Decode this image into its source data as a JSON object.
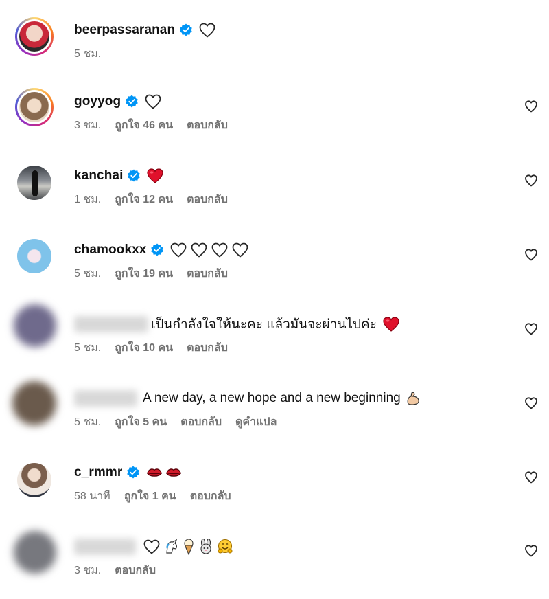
{
  "comments": [
    {
      "username": "beerpassaranan",
      "verified": true,
      "text": "",
      "time": "5 ชม.",
      "likes": "",
      "reply": "",
      "translate": ""
    },
    {
      "username": "goyyog",
      "verified": true,
      "text": "",
      "time": "3 ชม.",
      "likes": "ถูกใจ 46 คน",
      "reply": "ตอบกลับ",
      "translate": ""
    },
    {
      "username": "kanchai",
      "verified": true,
      "text": "",
      "time": "1 ชม.",
      "likes": "ถูกใจ 12 คน",
      "reply": "ตอบกลับ",
      "translate": ""
    },
    {
      "username": "chamookxx",
      "verified": true,
      "text": "",
      "time": "5 ชม.",
      "likes": "ถูกใจ 19 คน",
      "reply": "ตอบกลับ",
      "translate": ""
    },
    {
      "username": "",
      "verified": false,
      "text": "เป็นกำลังใจให้นะคะ แล้วมันจะผ่านไปค่ะ",
      "time": "5 ชม.",
      "likes": "ถูกใจ 10 คน",
      "reply": "ตอบกลับ",
      "translate": ""
    },
    {
      "username": "",
      "verified": false,
      "text": "A new day, a new hope and a new beginning",
      "time": "5 ชม.",
      "likes": "ถูกใจ 5 คน",
      "reply": "ตอบกลับ",
      "translate": "ดูคำแปล"
    },
    {
      "username": "c_rmmr",
      "verified": true,
      "text": "",
      "time": "58 นาที",
      "likes": "ถูกใจ 1 คน",
      "reply": "ตอบกลับ",
      "translate": ""
    },
    {
      "username": "",
      "verified": false,
      "text": "",
      "time": "3 ชม.",
      "likes": "",
      "reply": "ตอบกลับ",
      "translate": ""
    }
  ],
  "icons": {
    "verified": "verified-badge-icon",
    "heart_outline": "heart-outline-icon",
    "heart_red": "red-heart-icon",
    "like": "like-heart-icon",
    "flexed_biceps": "flexed-biceps-emoji",
    "kiss_lips": "kiss-lips-emoji",
    "unicorn": "unicorn-emoji",
    "ice_cream": "ice-cream-emoji",
    "rabbit": "rabbit-emoji",
    "hugging_face": "hugging-face-emoji"
  },
  "colors": {
    "verified": "#0095f6",
    "heart_red": "#e0112b",
    "meta": "#737373",
    "divider": "#dbdbdb"
  }
}
